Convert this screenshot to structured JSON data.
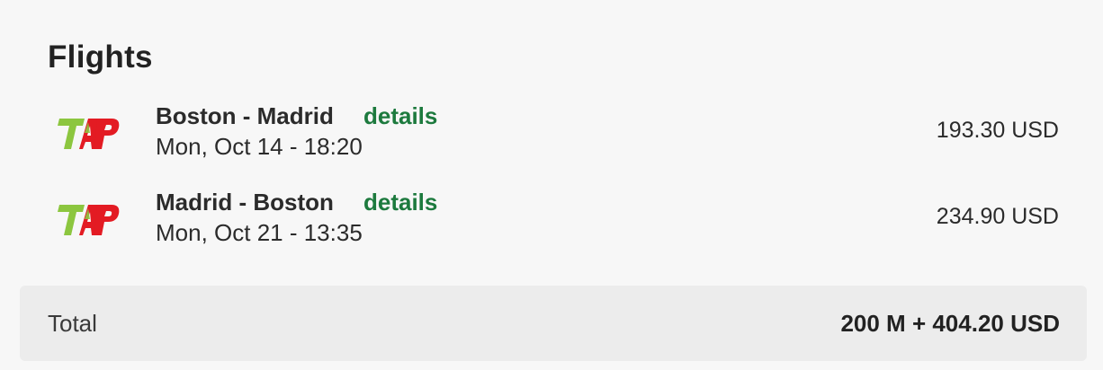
{
  "section": {
    "title": "Flights"
  },
  "flights": [
    {
      "airline_logo": "TAP",
      "route": "Boston - Madrid",
      "details_label": "details",
      "datetime": "Mon, Oct 14 - 18:20",
      "price": "193.30 USD"
    },
    {
      "airline_logo": "TAP",
      "route": "Madrid - Boston",
      "details_label": "details",
      "datetime": "Mon, Oct 21 - 13:35",
      "price": "234.90 USD"
    }
  ],
  "total": {
    "label": "Total",
    "value": "200 M + 404.20 USD"
  },
  "colors": {
    "link": "#1d7a3e",
    "logo_green": "#8cc63f",
    "logo_red": "#e31b23",
    "total_bg": "#ececec"
  }
}
